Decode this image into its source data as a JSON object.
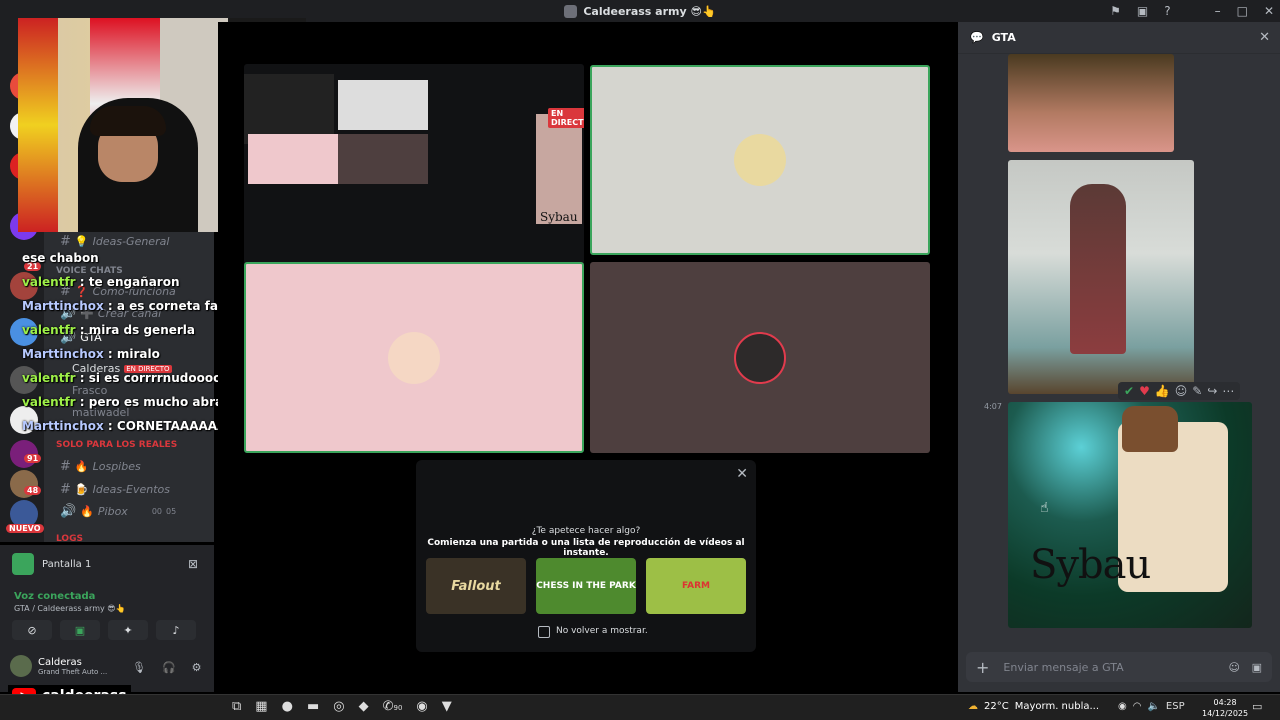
{
  "window": {
    "title": "Caldeerass army 😎👆"
  },
  "topright_icons": [
    "flag-icon",
    "inbox-icon",
    "help-icon",
    "minimize-icon",
    "maximize-icon",
    "close-icon"
  ],
  "guild_badges": [
    "21",
    "91",
    "48",
    "NUEVO"
  ],
  "channels": [
    {
      "label": "Ideas-General",
      "emoji": "💡"
    },
    {
      "label": "Voice chats",
      "type": "category"
    },
    {
      "label": "Como-funciona",
      "emoji": "❓"
    },
    {
      "label": "Crear canal",
      "emoji": "➕"
    },
    {
      "label": "GTA",
      "emoji": ""
    },
    {
      "label": "Calderas",
      "badge": "EN DIRECTO"
    },
    {
      "label": "Frasco"
    },
    {
      "label": "matiwadel"
    },
    {
      "label": "SOLO PARA LOS REALES",
      "type": "category"
    },
    {
      "label": "Lospibes",
      "emoji": "🔥"
    },
    {
      "label": "Ideas-Eventos",
      "emoji": "🍺"
    },
    {
      "label": "Pibox",
      "emoji": "🔥",
      "counts": [
        "00",
        "05"
      ]
    },
    {
      "label": "LOGS",
      "type": "category"
    }
  ],
  "stream_chat": [
    {
      "user": "",
      "text": "ese chabon"
    },
    {
      "user": "valentfr",
      "text": " : te engañaron"
    },
    {
      "user": "Marttinchox",
      "text": " : a es corneta facu?"
    },
    {
      "user": "valentfr",
      "text": " : mira ds generla"
    },
    {
      "user": "Marttinchox",
      "text": " : miralo"
    },
    {
      "user": "valentfr",
      "text": " : si es corrrrnudoooo"
    },
    {
      "user": "valentfr",
      "text": " : pero es mucho abrazo"
    },
    {
      "user": "Marttinchox",
      "text": " : CORNETAAAAAA"
    }
  ],
  "stage": {
    "share_badge": "EN DIRECTO",
    "share_text": "Sybau"
  },
  "activity": {
    "prompt": "¿Te apetece hacer algo?",
    "subprompt": "Comienza una partida o una lista de reproducción de vídeos al instante.",
    "games": [
      "Fallout",
      "CHESS IN THE PARK",
      "FARM"
    ],
    "dont_show": "No volver a mostrar."
  },
  "voice": {
    "screen_label": "Pantalla 1",
    "status": "Voz conectada",
    "location": "GTA / Caldeerass army 😎👆",
    "user": "Calderas",
    "user_status": "Grand Theft Auto ..."
  },
  "rightpanel": {
    "title": "GTA",
    "timestamp": "4:07",
    "image_text": "Sybau",
    "input_placeholder": "Enviar mensaje a GTA"
  },
  "youtube": {
    "channel": "caldeerass"
  },
  "taskbar": {
    "weather_temp": "22°C",
    "weather_text": "Mayorm. nubla...",
    "lang": "ESP",
    "time": "04:28",
    "date": "14/12/2025",
    "badge": "90"
  },
  "colors": {
    "accent": "#5865f2",
    "live": "#da373c",
    "online": "#3ba55c"
  }
}
